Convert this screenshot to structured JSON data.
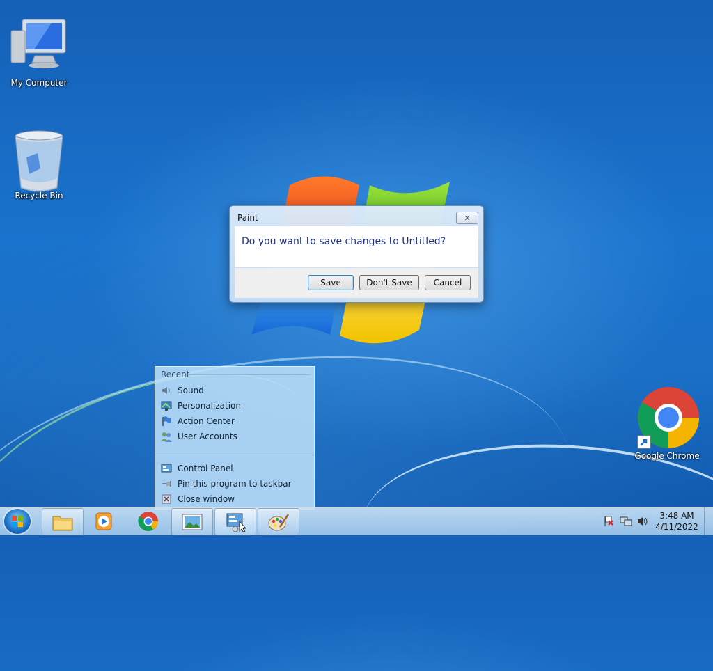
{
  "desktop": {
    "icons": [
      {
        "label": "My Computer"
      },
      {
        "label": "Recycle Bin"
      },
      {
        "label": "Google Chrome"
      }
    ]
  },
  "dialog": {
    "title": "Paint",
    "close_glyph": "✕",
    "message": "Do you want to save changes to Untitled?",
    "buttons": {
      "save": "Save",
      "dont_save": "Don't Save",
      "cancel": "Cancel"
    }
  },
  "jumplist": {
    "header": "Recent",
    "recent": [
      {
        "label": "Sound",
        "icon": "speaker-icon"
      },
      {
        "label": "Personalization",
        "icon": "monitor-icon"
      },
      {
        "label": "Action Center",
        "icon": "flag-icon"
      },
      {
        "label": "User Accounts",
        "icon": "users-icon"
      }
    ],
    "tasks": [
      {
        "label": "Control Panel",
        "icon": "control-panel-icon"
      },
      {
        "label": "Pin this program to taskbar",
        "icon": "pin-icon"
      },
      {
        "label": "Close window",
        "icon": "close-window-icon"
      }
    ]
  },
  "taskbar": {
    "buttons": [
      "explorer-icon",
      "media-player-icon",
      "chrome-icon",
      "image-viewer-icon",
      "control-panel-icon",
      "paint-icon"
    ],
    "clock": {
      "time": "3:48 AM",
      "date": "4/11/2022"
    }
  },
  "colors": {
    "dialog_text": "#1e3287",
    "taskbar": "#b4d4f0"
  }
}
